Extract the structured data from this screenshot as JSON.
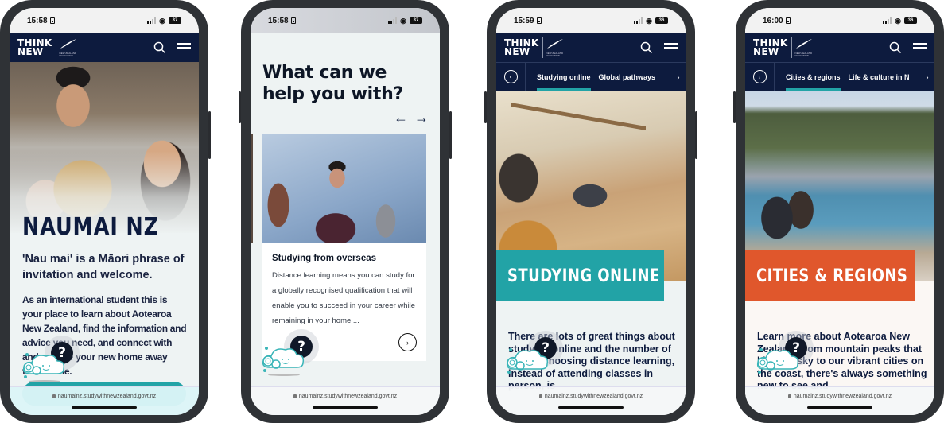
{
  "brand": {
    "logo_line1": "THINK",
    "logo_line2": "NEW",
    "logo_sub": "NEW ZEALAND EDUCATION",
    "colors": {
      "navy": "#0d1b3e",
      "teal": "#22a3a6",
      "orange": "#e0572c"
    }
  },
  "url": "naumainz.studywithnewzealand.govt.nz",
  "icons": {
    "search": "search-icon",
    "menu": "hamburger-menu-icon",
    "back": "chevron-left-icon",
    "next": "chevron-right-icon",
    "lock": "lock-icon",
    "chatbot": "chatbot-cloud-icon",
    "help": "question-mark-icon"
  },
  "phones": [
    {
      "status": {
        "time": "15:58",
        "battery": "37"
      },
      "hero_title": "NAUMAI NZ",
      "lead": "'Nau mai' is a Māori phrase of invitation and welcome.",
      "body": "As an international student this is your place to learn about Aotearoa New Zealand, find the information and advice you need, and connect with and explore your new home away from home."
    },
    {
      "status": {
        "time": "15:58",
        "battery": "37"
      },
      "heading": "What can we help you with?",
      "prev_arrow": "←",
      "next_arrow": "→",
      "card": {
        "title": "Studying from overseas",
        "text": "Distance learning means you can study for a globally recognised qualification that will enable you to succeed in your career while remaining in your home ...",
        "arrow": "›"
      }
    },
    {
      "status": {
        "time": "15:59",
        "battery": "36"
      },
      "subnav": {
        "back": "‹",
        "tabs": [
          "Studying online",
          "Global pathways"
        ],
        "active": 0,
        "next": "›"
      },
      "banner": "STUDYING ONLINE",
      "body": "There are lots of great things about studying online and the number of people choosing distance learning, instead of attending classes in person, is"
    },
    {
      "status": {
        "time": "16:00",
        "battery": "36"
      },
      "subnav": {
        "back": "‹",
        "tabs": [
          "Cities & regions",
          "Life & culture in N"
        ],
        "active": 0,
        "next": "›"
      },
      "banner": "CITIES & REGIONS",
      "body": "Learn more about Aotearoa New Zealand, from mountain peaks that kiss the sky to our vibrant cities on the coast, there's always something new to see and"
    }
  ],
  "chatbot": {
    "help_glyph": "?"
  }
}
